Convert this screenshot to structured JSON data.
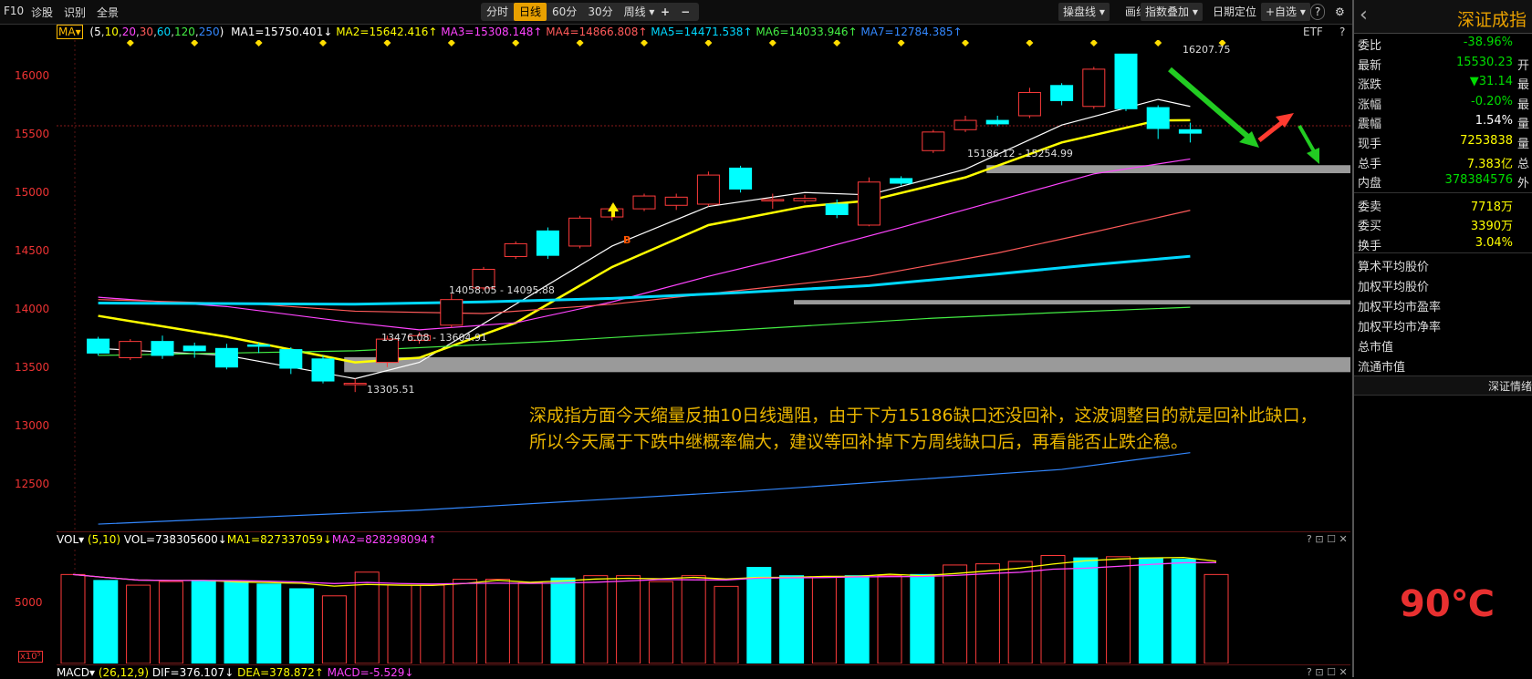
{
  "toolbar": {
    "left_items": [
      "F10",
      "诊股",
      "识别",
      "全景"
    ],
    "periods": [
      "分时",
      "日线",
      "60分",
      "30分",
      "周线 ▾"
    ],
    "active_period": "日线",
    "zoom": [
      "+",
      "−"
    ],
    "right_items": [
      "操盘线 ▾",
      "画线",
      "指数叠加 ▾",
      "日期定位",
      "+自选 ▾",
      "?",
      "⚙"
    ]
  },
  "ma_legend": {
    "selector": "MA▾",
    "params_prefix": "(",
    "params": [
      "5",
      "10",
      "20",
      "30",
      "60",
      "120",
      "250"
    ],
    "params_suffix": ")",
    "items": [
      {
        "label": "MA1=15750.401↓",
        "color": "#ffffff"
      },
      {
        "label": "MA2=15642.416↑",
        "color": "#ffff00"
      },
      {
        "label": "MA3=15308.148↑",
        "color": "#ff44ff"
      },
      {
        "label": "MA4=14866.808↑",
        "color": "#ff5a5a"
      },
      {
        "label": "MA5=14471.538↑",
        "color": "#00d8ff"
      },
      {
        "label": "MA6=14033.946↑",
        "color": "#44ee44"
      },
      {
        "label": "MA7=12784.385↑",
        "color": "#3388ff"
      }
    ],
    "etf": "ETF",
    "help": "?"
  },
  "yaxis": [
    "16000",
    "15500",
    "15000",
    "14500",
    "14000",
    "13500",
    "13000",
    "12500"
  ],
  "annotations": {
    "high": "16207.75",
    "gap_upper": "15186.12 - 15254.99",
    "gap_middle": "14058.05 - 14095.88",
    "gap_lower": "13476.08 - 13604.91",
    "low": "13305.51",
    "signal": "B"
  },
  "note_lines": [
    "深成指方面今天缩量反抽10日线遇阻，由于下方15186缺口还没回补，这波调整目的就是回补此缺口，",
    "所以今天属于下跌中继概率偏大，建议等回补掉下方周线缺口后，再看能否止跌企稳。"
  ],
  "chart_data": {
    "type": "candlestick",
    "candles": [
      [
        13760,
        13640,
        13780,
        13620
      ],
      [
        13600,
        13740,
        13760,
        13580
      ],
      [
        13740,
        13620,
        13790,
        13590
      ],
      [
        13700,
        13660,
        13730,
        13600
      ],
      [
        13680,
        13520,
        13720,
        13500
      ],
      [
        13710,
        13700,
        13730,
        13640
      ],
      [
        13670,
        13510,
        13690,
        13460
      ],
      [
        13590,
        13400,
        13620,
        13380
      ],
      [
        13380,
        13380,
        13420,
        13305
      ],
      [
        13560,
        13760,
        13790,
        13520
      ],
      [
        13750,
        13790,
        13820,
        13720
      ],
      [
        13880,
        14100,
        14150,
        13860
      ],
      [
        14200,
        14360,
        14380,
        14180
      ],
      [
        14470,
        14580,
        14600,
        14450
      ],
      [
        14690,
        14480,
        14720,
        14450
      ],
      [
        14560,
        14800,
        14820,
        14540
      ],
      [
        14810,
        14880,
        14920,
        14780
      ],
      [
        14880,
        14990,
        15010,
        14860
      ],
      [
        14910,
        14980,
        15010,
        14870
      ],
      [
        14920,
        15170,
        15200,
        14900
      ],
      [
        15230,
        15050,
        15250,
        15020
      ],
      [
        14950,
        14960,
        15010,
        14880
      ],
      [
        14950,
        14970,
        15000,
        14930
      ],
      [
        14920,
        14830,
        14960,
        14800
      ],
      [
        14740,
        15110,
        15150,
        14730
      ],
      [
        15140,
        15100,
        15160,
        15080
      ],
      [
        15380,
        15540,
        15560,
        15360
      ],
      [
        15560,
        15640,
        15680,
        15540
      ],
      [
        15640,
        15610,
        15680,
        15590
      ],
      [
        15680,
        15880,
        15920,
        15660
      ],
      [
        15940,
        15810,
        15960,
        15770
      ],
      [
        15760,
        16080,
        16100,
        15740
      ],
      [
        16210,
        15740,
        16208,
        15720
      ],
      [
        15750,
        15570,
        15770,
        15480
      ],
      [
        15560,
        15530,
        15620,
        15450
      ]
    ],
    "ma_series": [
      {
        "name": "MA1",
        "color": "#ffffff",
        "values": [
          [
            0,
            13680
          ],
          [
            4,
            13620
          ],
          [
            8,
            13420
          ],
          [
            10,
            13560
          ],
          [
            13,
            14060
          ],
          [
            16,
            14560
          ],
          [
            19,
            14900
          ],
          [
            22,
            15020
          ],
          [
            24,
            15000
          ],
          [
            27,
            15220
          ],
          [
            30,
            15600
          ],
          [
            33,
            15820
          ],
          [
            34,
            15760
          ]
        ]
      },
      {
        "name": "MA2",
        "color": "#ffff00",
        "values": [
          [
            0,
            13960
          ],
          [
            4,
            13780
          ],
          [
            8,
            13560
          ],
          [
            10,
            13600
          ],
          [
            13,
            13900
          ],
          [
            16,
            14380
          ],
          [
            19,
            14740
          ],
          [
            22,
            14900
          ],
          [
            24,
            14950
          ],
          [
            27,
            15150
          ],
          [
            30,
            15450
          ],
          [
            33,
            15640
          ],
          [
            34,
            15642
          ]
        ]
      },
      {
        "name": "MA3",
        "color": "#ff44ff",
        "values": [
          [
            0,
            14120
          ],
          [
            4,
            14040
          ],
          [
            8,
            13900
          ],
          [
            10,
            13840
          ],
          [
            13,
            13900
          ],
          [
            16,
            14080
          ],
          [
            19,
            14300
          ],
          [
            22,
            14500
          ],
          [
            25,
            14720
          ],
          [
            28,
            14950
          ],
          [
            31,
            15180
          ],
          [
            34,
            15308
          ]
        ]
      },
      {
        "name": "MA4",
        "color": "#ff5a5a",
        "values": [
          [
            0,
            14100
          ],
          [
            5,
            14060
          ],
          [
            8,
            14000
          ],
          [
            12,
            13980
          ],
          [
            16,
            14060
          ],
          [
            20,
            14180
          ],
          [
            24,
            14300
          ],
          [
            28,
            14500
          ],
          [
            31,
            14680
          ],
          [
            34,
            14867
          ]
        ]
      },
      {
        "name": "MA5",
        "color": "#00d8ff",
        "values": [
          [
            0,
            14070
          ],
          [
            8,
            14060
          ],
          [
            12,
            14080
          ],
          [
            16,
            14110
          ],
          [
            20,
            14160
          ],
          [
            24,
            14220
          ],
          [
            28,
            14320
          ],
          [
            31,
            14400
          ],
          [
            34,
            14472
          ]
        ]
      },
      {
        "name": "MA6",
        "color": "#44ee44",
        "values": [
          [
            0,
            13620
          ],
          [
            8,
            13660
          ],
          [
            14,
            13740
          ],
          [
            20,
            13840
          ],
          [
            26,
            13940
          ],
          [
            30,
            13990
          ],
          [
            34,
            14034
          ]
        ]
      },
      {
        "name": "MA7",
        "color": "#3388ff",
        "values": [
          [
            0,
            12170
          ],
          [
            10,
            12290
          ],
          [
            20,
            12450
          ],
          [
            30,
            12640
          ],
          [
            34,
            12784
          ]
        ]
      }
    ],
    "gaps": [
      [
        15186.12,
        15254.99
      ],
      [
        14058.05,
        14095.88
      ],
      [
        13476.08,
        13604.91
      ]
    ],
    "ylim": [
      12100,
      16330
    ],
    "volume": {
      "values": [
        7500,
        7000,
        6600,
        6900,
        7000,
        6900,
        6700,
        6300,
        5700,
        7700,
        6600,
        6600,
        7100,
        7100,
        6800,
        7200,
        7400,
        7400,
        6900,
        7400,
        6500,
        8100,
        7400,
        7300,
        7400,
        7400,
        7500,
        8300,
        8400,
        8600,
        9100,
        8900,
        9000,
        8900,
        8800,
        7500
      ],
      "filled": [
        false,
        true,
        false,
        false,
        true,
        true,
        true,
        true,
        false,
        false,
        false,
        false,
        false,
        false,
        false,
        true,
        false,
        false,
        false,
        false,
        false,
        true,
        true,
        false,
        true,
        false,
        true,
        false,
        false,
        false,
        false,
        true,
        false,
        true,
        true,
        false
      ],
      "ylim": [
        0,
        9600
      ],
      "label_5000": "5000",
      "unit": "x10⁵"
    }
  },
  "vol_legend": {
    "selector": "VOL▾",
    "params": "(5,10)",
    "vol": "VOL=738305600↓",
    "ma1": "MA1=827337059↓",
    "ma2": "MA2=828298094↑"
  },
  "macd_legend": {
    "selector": "MACD▾",
    "params": "(26,12,9)",
    "dif": "DIF=376.107↓",
    "dea": "DEA=378.872↑",
    "macd": "MACD=-5.529↓"
  },
  "panel_icons": [
    "?",
    "⊡",
    "☐",
    "✕"
  ],
  "right_panel": {
    "back": "‹",
    "title": "深证成指",
    "quotes": [
      {
        "k": "委比",
        "v": "-38.96%",
        "c": "#00dd00",
        "s": ""
      },
      {
        "k": "最新",
        "v": "15530.23",
        "c": "#00dd00",
        "s": "开"
      },
      {
        "k": "涨跌",
        "v": "▼31.14",
        "c": "#00dd00",
        "s": "最"
      },
      {
        "k": "涨幅",
        "v": "-0.20%",
        "c": "#00dd00",
        "s": "最"
      },
      {
        "k": "震幅",
        "v": "1.54%",
        "c": "#ffffff",
        "s": "量"
      },
      {
        "k": "现手",
        "v": "7253838",
        "c": "#ffff00",
        "s": "量"
      },
      {
        "k": "总手",
        "v": "7.383亿",
        "c": "#ffff00",
        "s": "总"
      },
      {
        "k": "内盘",
        "v": "378384576",
        "c": "#00dd00",
        "s": "外"
      },
      {
        "k": "委卖",
        "v": "7718万",
        "c": "#ffff00",
        "s": ""
      },
      {
        "k": "委买",
        "v": "3390万",
        "c": "#ffff00",
        "s": ""
      },
      {
        "k": "换手",
        "v": "3.04%",
        "c": "#ffff00",
        "s": ""
      }
    ],
    "links": [
      "算术平均股价",
      "加权平均股价",
      "加权平均市盈率",
      "加权平均市净率",
      "总市值",
      "流通市值"
    ],
    "sentiment_title": "深证情绪",
    "temperature": "90℃"
  }
}
